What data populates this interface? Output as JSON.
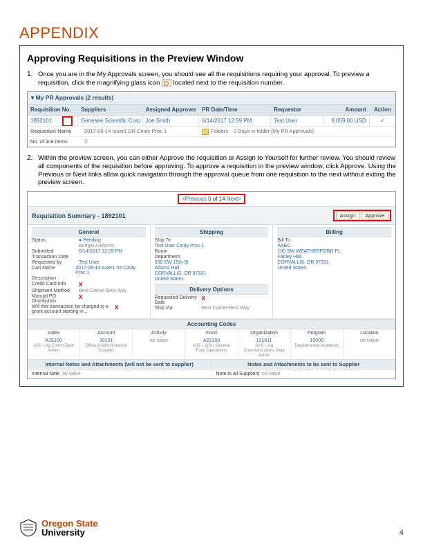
{
  "title": "APPENDIX",
  "section_title": "Approving Requisitions in the Preview Window",
  "step1": {
    "num": "1.",
    "text_a": "Once you are in the My Approvals screen, you should see all the requisitions requiring your approval.  To preview a requisition, click the magnifying glass icon ",
    "text_b": " located next to the requisition number."
  },
  "step2": {
    "num": "2.",
    "text": "Within the preview screen, you can either Approve the requisition or Assign to Yourself for further review. You should review all components of the requisition before approving. To approve a requisition in the preview window, click Approve. Using the Previous or Next links allow quick navigation through the approval queue from one requisition to the next without exiting the preview screen."
  },
  "shot1": {
    "titlebar": "My PR Approvals (2 results)",
    "headers": {
      "req": "Requisition No.",
      "sup": "Suppliers",
      "app": "Assigned Approver",
      "dt": "PR Date/Time",
      "reqr": "Requestor",
      "amt": "Amount",
      "act": "Action"
    },
    "row": {
      "req": "1892101",
      "sup": "Genesee Scientific Corp",
      "app": "Joe Smith",
      "dt": "6/14/2017 12:59 PM",
      "reqr": "Test User",
      "amt": "9,059.00 USD",
      "act": "✓"
    },
    "d1_label": "Requisition Name",
    "d1_val": "2017-06-14 tuser1 DR Cindy Proc 1",
    "d2_label": "No. of line items",
    "d2_val": "2",
    "d3_label": "Folders",
    "d3_val": "Folders",
    "d4_val": "0 Days in folder [My PR Approvals]"
  },
  "shot2": {
    "prev": "<Previous",
    "pager": "0 of 14",
    "next": "Next>",
    "sum_title": "Requisition Summary - 1892101",
    "btn_assign": "Assign",
    "btn_approve": "Approve",
    "sec_general": "General",
    "sec_shipping": "Shipping",
    "sec_billing": "Billing",
    "g": {
      "status_k": "Status",
      "status_v": "Pending",
      "status_sub": "Budget Authority",
      "sub_k": "Submitted",
      "sub_v": "6/14/2017 12:59 PM",
      "td_k": "Transaction Date",
      "td_v": "",
      "rb_k": "Requested by",
      "rb_v": "Test User",
      "cn_k": "Cart Name",
      "cn_v": "2017-06-14 tuser1 04 Cindy Proc 1",
      "ds_k": "Description",
      "ds_v": "",
      "cc_k": "Credit Card Info",
      "cc_v": "X",
      "sm_k": "Shipment Method",
      "sm_v": "Best Carrier-Best Way",
      "mp_k": "Manual PO Distribution",
      "mp_v": "X",
      "wa_k": "Will this transaction be charged to a grant account starting in...",
      "wa_v": "X"
    },
    "s": {
      "shipto_k": "Ship To",
      "shipto_v": "Test User Cindy Proc 1",
      "room_k": "Room",
      "room_v": "",
      "dept_k": "Department",
      "dept_v": "",
      "addr1": "500 SW 15th St",
      "addr2": "Adams Hall",
      "addr3": "CORVALLIS, OR 97331",
      "addr4": "United States",
      "del_head": "Delivery Options",
      "shipvia_k": "Ship Via",
      "shipvia_v": "Best Carrier-Best Way",
      "reqdate_k": "Requested Delivery Date",
      "reqdate_v": "X"
    },
    "b": {
      "billto_k": "Bill To",
      "billto_v": "AABC",
      "addr1": "100 SW WEATHERFORD PL",
      "addr2": "Fairley Hall",
      "addr3": "CORVALLIS, OR 97331",
      "addr4": "United States"
    },
    "acc_title": "Accounting Codes",
    "acc_heads": {
      "index": "Index",
      "acct": "Account",
      "activity": "Activity",
      "fund": "Fund",
      "org": "Organization",
      "prog": "Program",
      "loc": "Location"
    },
    "acc_vals": {
      "index": "AJS100",
      "index_sub": "AJS – Ag Comm Dept Admin",
      "acct": "30101",
      "acct_sub": "Office & Administrative Supplies",
      "activity": "no value",
      "fund": "AJS100",
      "fund_sub": "AJS – OSU General Fund Operations",
      "org": "121011",
      "org_sub": "AAS – Ag Communications Dept Admin",
      "prog": "10000",
      "prog_sub": "Departmental Academic",
      "loc": "no value"
    },
    "notes_int_h": "Internal Notes and Attachments (will not be sent to supplier)",
    "notes_sup_h": "Notes and Attachments to be sent to Supplier",
    "notes_int_k": "Internal Note",
    "notes_int_v": "no value",
    "notes_sup_k": "Note to all Suppliers",
    "notes_sup_v": "no value"
  },
  "footer": {
    "l1": "Oregon State",
    "l2": "University",
    "page": "4"
  }
}
